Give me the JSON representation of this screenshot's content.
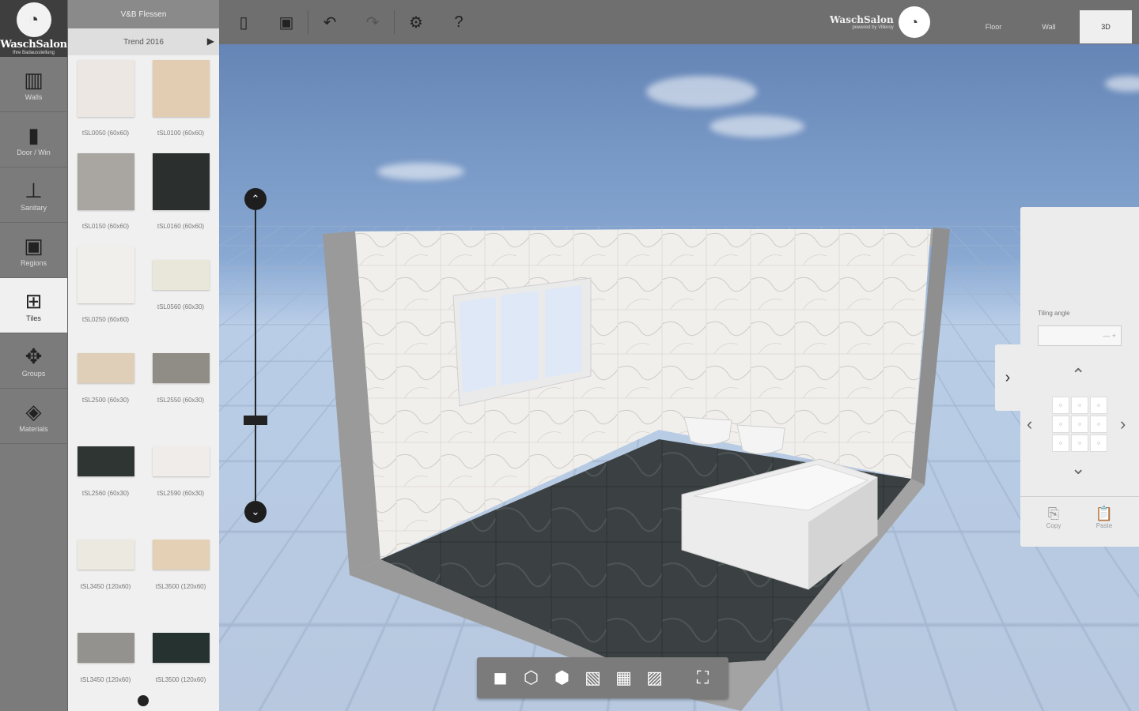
{
  "brand": {
    "logo_text": "WaschSalon",
    "logo_sub": "Ihre Badausstellung",
    "top_brand": "WaschSalon",
    "top_brand_sub": "powered by Villeroy"
  },
  "sidebar": {
    "items": [
      {
        "label": "Walls",
        "icon": "walls-icon",
        "glyph": "▥"
      },
      {
        "label": "Door / Win",
        "icon": "door-icon",
        "glyph": "▮"
      },
      {
        "label": "Sanitary",
        "icon": "sink-icon",
        "glyph": "⊥"
      },
      {
        "label": "Regions",
        "icon": "regions-icon",
        "glyph": "▣"
      },
      {
        "label": "Tiles",
        "icon": "tiles-icon",
        "glyph": "⊞"
      },
      {
        "label": "Groups",
        "icon": "groups-icon",
        "glyph": "✥"
      },
      {
        "label": "Materials",
        "icon": "materials-icon",
        "glyph": "◈"
      }
    ],
    "active": "Tiles"
  },
  "catalog": {
    "header": "V&B Flessen",
    "subheader": "Trend 2016",
    "tiles": [
      {
        "code": "tSL0050 (60x60)",
        "color": "#ece7e2"
      },
      {
        "code": "tSL0100 (60x60)",
        "color": "#e2cdb3"
      },
      {
        "code": "tSL0150 (60x60)",
        "color": "#a9a6a1"
      },
      {
        "code": "tSL0160 (60x60)",
        "color": "#2b302e"
      },
      {
        "code": "tSL0250 (60x60)",
        "color": "#f1efec"
      },
      {
        "code": "tSL0560 (60x30)",
        "color": "#e9e6da"
      },
      {
        "code": "tSL2500 (60x30)",
        "color": "#dfcfb8"
      },
      {
        "code": "tSL2550 (60x30)",
        "color": "#908d87"
      },
      {
        "code": "tSL2560 (60x30)",
        "color": "#2f3532"
      },
      {
        "code": "tSL2590 (60x30)",
        "color": "#f0ecea"
      },
      {
        "code": "tSL3450 (120x60)",
        "color": "#ece9e0"
      },
      {
        "code": "tSL3500 (120x60)",
        "color": "#e3d0b5"
      },
      {
        "code": "tSL3450 (120x60)",
        "color": "#94928e"
      },
      {
        "code": "tSL3500 (120x60)",
        "color": "#263230"
      }
    ]
  },
  "toolbar": {
    "buttons": [
      {
        "name": "new-file",
        "glyph": "🗋"
      },
      {
        "name": "save",
        "glyph": "🖫"
      },
      {
        "name": "undo",
        "glyph": "↶"
      },
      {
        "name": "redo",
        "glyph": "↷"
      },
      {
        "name": "settings",
        "glyph": "⚙"
      },
      {
        "name": "help",
        "glyph": "?"
      }
    ],
    "view_tabs": [
      "Floor",
      "Wall",
      "3D"
    ],
    "active_view": "3D"
  },
  "viewbar": {
    "buttons": [
      {
        "name": "view-solid",
        "glyph": "◼"
      },
      {
        "name": "view-cube-1",
        "glyph": "⬡"
      },
      {
        "name": "view-cube-2",
        "glyph": "⬢"
      },
      {
        "name": "view-cube-3",
        "glyph": "▧"
      },
      {
        "name": "view-cube-4",
        "glyph": "▦"
      },
      {
        "name": "view-cube-5",
        "glyph": "▨"
      },
      {
        "name": "fullscreen",
        "glyph": "⛶"
      }
    ]
  },
  "right_panel": {
    "tilt_label": "Tiling angle",
    "tilt_value": "— +",
    "grid": [
      "○",
      "○",
      "○",
      "○",
      "○",
      "○",
      "○",
      "○",
      "○"
    ],
    "copy_label": "Copy",
    "paste_label": "Paste"
  },
  "colors": {
    "sidebar": "#7b7b7b",
    "toolbar": "#6f6f6f",
    "floor": "#3a3f40",
    "wall": "#f1efec"
  }
}
